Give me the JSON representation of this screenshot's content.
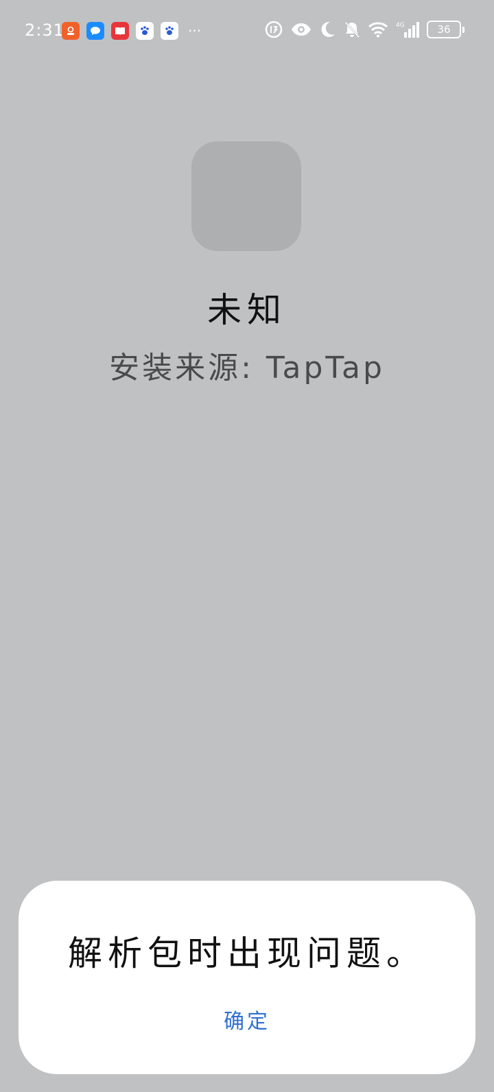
{
  "status_bar": {
    "time": "2:31",
    "notification_icons": [
      {
        "name": "red-app-icon",
        "color": "#f0612a"
      },
      {
        "name": "chat-bubble-icon",
        "color": "#1a8cff"
      },
      {
        "name": "red-book-icon",
        "color": "#e8353a"
      },
      {
        "name": "baidu-paw-icon",
        "color": "#ffffff"
      },
      {
        "name": "baidu-paw-icon",
        "color": "#ffffff"
      }
    ],
    "more_indicator": "···",
    "battery_level": "36"
  },
  "app_info": {
    "name": "未知",
    "source": "安装来源: TapTap"
  },
  "dialog": {
    "message": "解析包时出现问题。",
    "ok_label": "确定",
    "ok_color": "#2f6fd0"
  }
}
